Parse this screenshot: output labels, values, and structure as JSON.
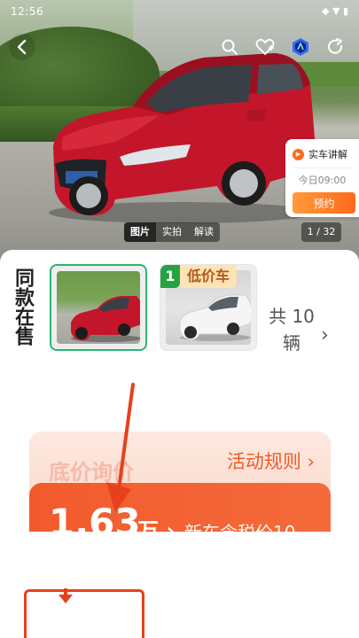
{
  "status_bar": {
    "time": "12:56",
    "icons": "◆ ▼ ▮"
  },
  "nav": {
    "back_icon": "chevron-left-icon",
    "search_icon": "search-icon",
    "favorite_icon": "heart-plus-icon",
    "brand_icon": "brand-hexagon-icon",
    "share_icon": "share-icon"
  },
  "live_card": {
    "title": "实车讲解",
    "time": "今日09:00",
    "button": "预约"
  },
  "photo_tabs": [
    {
      "label": "图片",
      "active": true
    },
    {
      "label": "实拍",
      "active": false
    },
    {
      "label": "解读",
      "active": false
    }
  ],
  "photo_counter": "1 / 32",
  "same_style": {
    "label": "同款在售",
    "badge_rank": "1",
    "badge_text": "低价车",
    "total": "共 10辆"
  },
  "promo": {
    "bg_title": "底价询价",
    "rules": "活动规则 ›",
    "price": "1.63",
    "unit": "万 ›",
    "new_car": "新车含税价10"
  },
  "colors": {
    "accent": "#f25a2c",
    "green": "#25a244",
    "annotation": "#e8401b"
  }
}
